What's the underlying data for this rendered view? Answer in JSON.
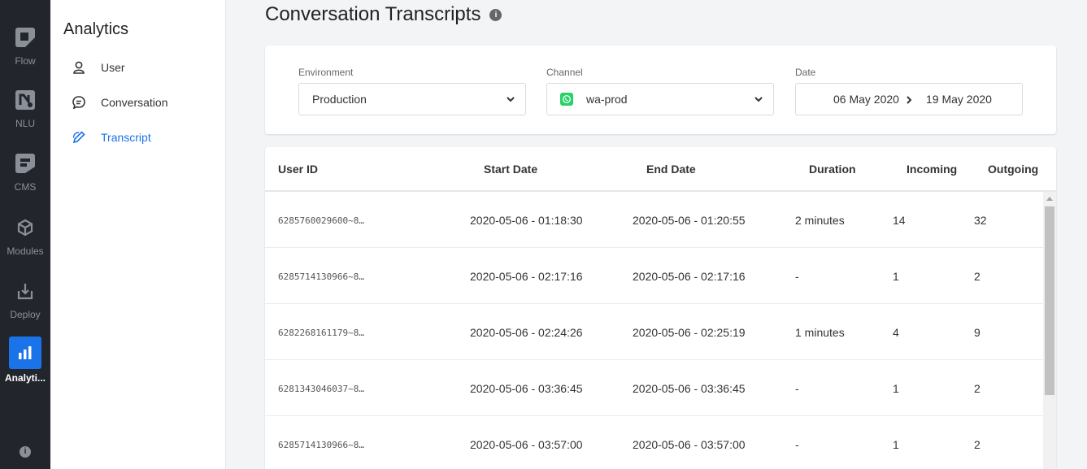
{
  "rail": {
    "items": [
      {
        "label": "Flow",
        "icon": "flow-icon"
      },
      {
        "label": "NLU",
        "icon": "nlu-icon"
      },
      {
        "label": "CMS",
        "icon": "cms-icon"
      },
      {
        "label": "Modules",
        "icon": "modules-icon"
      },
      {
        "label": "Deploy",
        "icon": "deploy-icon"
      },
      {
        "label": "Analyti...",
        "icon": "bar-chart-icon",
        "active": true
      }
    ],
    "accent": "#1a73e8"
  },
  "sidebar": {
    "title": "Analytics",
    "items": [
      {
        "label": "User",
        "icon": "user-icon"
      },
      {
        "label": "Conversation",
        "icon": "chat-icon"
      },
      {
        "label": "Transcript",
        "icon": "edit-icon",
        "active": true
      }
    ]
  },
  "page": {
    "title": "Conversation Transcripts"
  },
  "filters": {
    "environment": {
      "label": "Environment",
      "value": "Production"
    },
    "channel": {
      "label": "Channel",
      "value": "wa-prod",
      "icon": "whatsapp-icon"
    },
    "date": {
      "label": "Date",
      "start": "06 May 2020",
      "end": "19 May 2020"
    }
  },
  "table": {
    "columns": [
      "User ID",
      "Start Date",
      "End Date",
      "Duration",
      "Incoming",
      "Outgoing"
    ],
    "rows": [
      {
        "user_id": "6285760029600~8…",
        "start": "2020-05-06 - 01:18:30",
        "end": "2020-05-06 - 01:20:55",
        "duration": "2 minutes",
        "incoming": "14",
        "outgoing": "32"
      },
      {
        "user_id": "6285714130966~8…",
        "start": "2020-05-06 - 02:17:16",
        "end": "2020-05-06 - 02:17:16",
        "duration": "-",
        "incoming": "1",
        "outgoing": "2"
      },
      {
        "user_id": "6282268161179~8…",
        "start": "2020-05-06 - 02:24:26",
        "end": "2020-05-06 - 02:25:19",
        "duration": "1 minutes",
        "incoming": "4",
        "outgoing": "9"
      },
      {
        "user_id": "6281343046037~8…",
        "start": "2020-05-06 - 03:36:45",
        "end": "2020-05-06 - 03:36:45",
        "duration": "-",
        "incoming": "1",
        "outgoing": "2"
      },
      {
        "user_id": "6285714130966~8…",
        "start": "2020-05-06 - 03:57:00",
        "end": "2020-05-06 - 03:57:00",
        "duration": "-",
        "incoming": "1",
        "outgoing": "2"
      }
    ]
  }
}
